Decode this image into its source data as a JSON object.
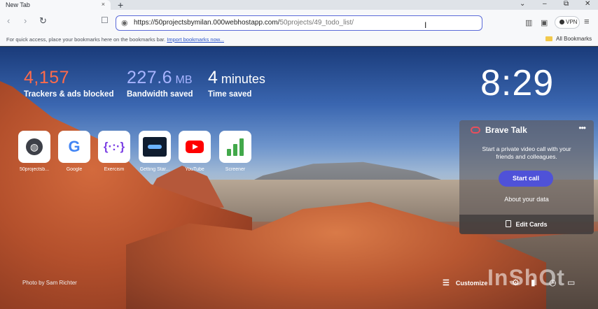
{
  "tab": {
    "title": "New Tab",
    "close_glyph": "×",
    "new_tab_glyph": "+"
  },
  "window_controls": {
    "minimize": "–",
    "maximize": "⧉",
    "close": "✕",
    "dropdown": "⌄"
  },
  "toolbar": {
    "back_glyph": "‹",
    "forward_glyph": "›",
    "reload_glyph": "↻",
    "bookmark_glyph": "☐",
    "url_host": "https://50projectsbymilan.000webhostapp.com/",
    "url_path": "50projects/49_todo_list/",
    "vpn_label": "VPN",
    "menu_glyph": "≡"
  },
  "bookmarks_bar": {
    "hint": "For quick access, place your bookmarks here on the bookmarks bar.",
    "import_link": "Import bookmarks now...",
    "all_bookmarks": "All Bookmarks"
  },
  "stats": [
    {
      "value": "4,157",
      "unit": "",
      "label": "Trackers & ads blocked",
      "color": "#ff6b4a"
    },
    {
      "value": "227.6",
      "unit": "MB",
      "label": "Bandwidth saved",
      "color": "#a8b4ff"
    },
    {
      "value": "4",
      "unit": "minutes",
      "label": "Time saved",
      "color": "#ffffff"
    }
  ],
  "clock": "8:29",
  "top_sites": [
    {
      "label": "50projectsb...",
      "icon": "globe-icon"
    },
    {
      "label": "Google",
      "icon": "google-icon"
    },
    {
      "label": "Exercism",
      "icon": "exercism-icon"
    },
    {
      "label": "Getting Star...",
      "icon": "getting-started-icon"
    },
    {
      "label": "YouTube",
      "icon": "youtube-icon"
    },
    {
      "label": "Screener",
      "icon": "screener-icon"
    }
  ],
  "brave_talk": {
    "title": "Brave Talk",
    "more_glyph": "•••",
    "description": "Start a private video call with your friends and colleagues.",
    "start_call": "Start call",
    "about_data": "About your data",
    "edit_cards": "Edit Cards"
  },
  "footer": {
    "photo_credit": "Photo by Sam Richter",
    "customize": "Customize"
  },
  "watermark": "InShOt",
  "colors": {
    "url_focus": "#5b6bd8",
    "start_call": "#4f52d8",
    "brave_talk_icon": "#e94f5c"
  }
}
